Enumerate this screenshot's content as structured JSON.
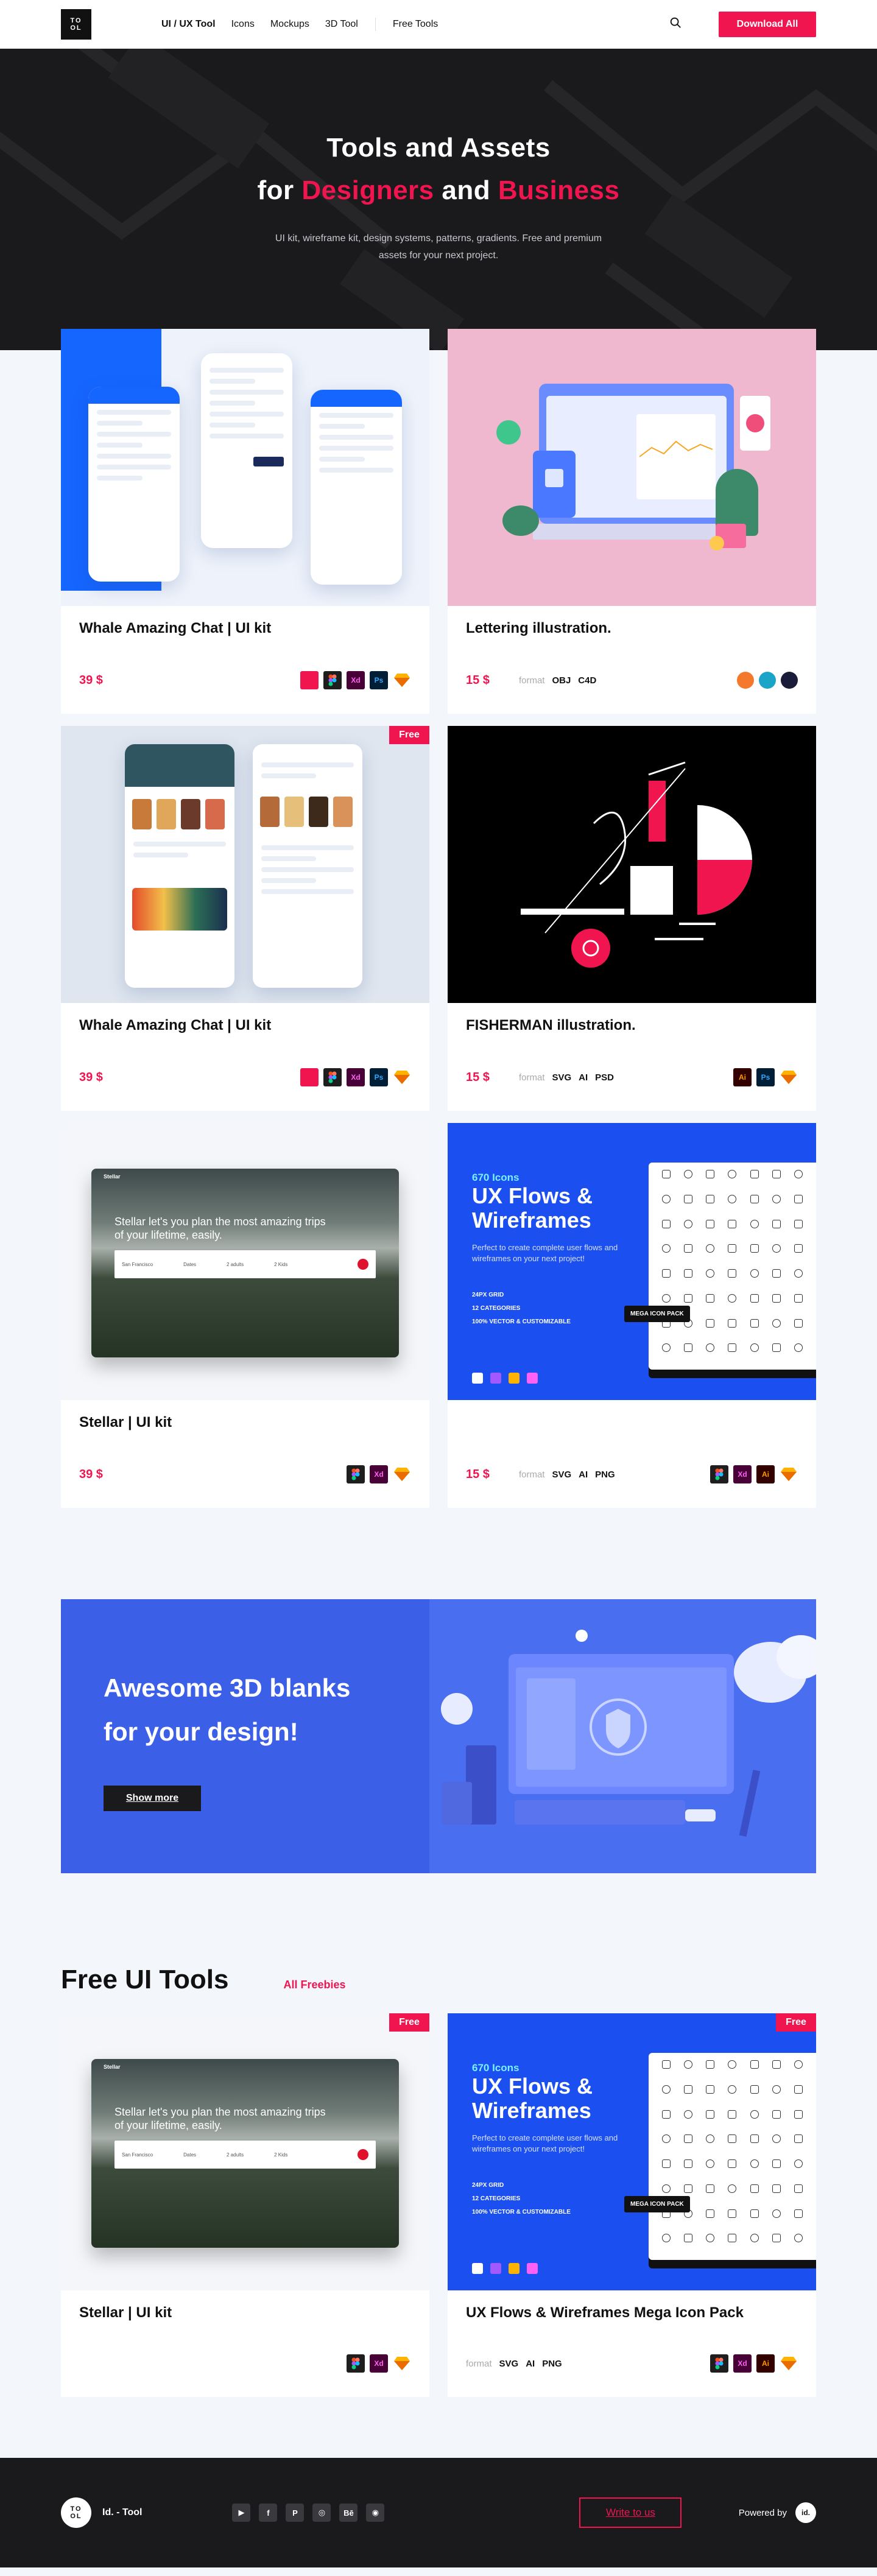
{
  "nav": {
    "logo_top": "TO",
    "logo_bottom": "OL",
    "links": [
      "UI / UX Tool",
      "Icons",
      "Mockups",
      "3D Tool",
      "Free Tools"
    ],
    "download_label": "Download All"
  },
  "hero": {
    "line1": "Tools and Assets",
    "line2_pre": "for ",
    "line2_a": "Designers",
    "line2_mid": " and ",
    "line2_b": "Business",
    "subtitle": "UI kit, wireframe kit, design systems, patterns, gradients. Free and premium assets for your next project."
  },
  "products": [
    {
      "title": "Whale Amazing Chat | UI kit",
      "price": "39 $",
      "format": [],
      "tools": [
        "protopie",
        "figma",
        "xd",
        "ps",
        "sketch"
      ],
      "free": false
    },
    {
      "title": "Lettering  illustration.",
      "price": "15 $",
      "format_label": "format",
      "format": [
        "OBJ",
        "C4D"
      ],
      "tools": [
        "blender",
        "cinema4d",
        "c4d-dark"
      ],
      "free": false
    },
    {
      "title": "Whale Amazing Chat | UI kit",
      "price": "39 $",
      "format": [],
      "tools": [
        "protopie",
        "figma",
        "xd",
        "ps",
        "sketch"
      ],
      "free": true
    },
    {
      "title": "FISHERMAN  illustration.",
      "price": "15 $",
      "format_label": "format",
      "format": [
        "SVG",
        "AI",
        "PSD"
      ],
      "tools": [
        "ai",
        "ps",
        "sketch"
      ],
      "free": false
    },
    {
      "title": "Stellar | UI kit",
      "price": "39 $",
      "format": [],
      "tools": [
        "figma",
        "xd",
        "sketch"
      ],
      "free": false
    },
    {
      "title": "",
      "price": "15 $",
      "format_label": "format",
      "format": [
        "SVG",
        "AI",
        "PNG"
      ],
      "tools": [
        "figma",
        "xd",
        "ai",
        "sketch"
      ],
      "free": false
    }
  ],
  "free_badge": "Free",
  "iconpack": {
    "count": "670 Icons",
    "title": "UX Flows & Wireframes",
    "desc": "Perfect to create complete user flows and wireframes on your next project!",
    "feat1": "24PX GRID",
    "feat2": "12 CATEGORIES",
    "feat3": "100% VECTOR & CUSTOMIZABLE",
    "mega": "MEGA ICON PACK"
  },
  "stellar": {
    "nav_brand": "Stellar",
    "headline": "Stellar let's you plan the most amazing trips of your lifetime, easily.",
    "fields": [
      "San Francisco",
      "Dates",
      "2 adults",
      "2 Kids"
    ]
  },
  "banner": {
    "title_line1": "Awesome 3D blanks",
    "title_line2": "for your design!",
    "button": "Show more"
  },
  "free_section": {
    "heading": "Free UI Tools",
    "link": "All Freebies",
    "items": [
      {
        "title": "Stellar | UI kit",
        "format": [],
        "tools": [
          "figma",
          "xd",
          "sketch"
        ]
      },
      {
        "title": "UX Flows & Wireframes Mega Icon Pack",
        "format_label": "format",
        "format": [
          "SVG",
          "AI",
          "PNG"
        ],
        "tools": [
          "figma",
          "xd",
          "ai",
          "sketch"
        ]
      }
    ]
  },
  "footer": {
    "logo_top": "TO",
    "logo_bottom": "OL",
    "brand": "Id. - Tool",
    "socials": [
      "youtube",
      "facebook",
      "pinterest",
      "instagram",
      "behance",
      "dribbble"
    ],
    "social_glyphs": [
      "▶",
      "f",
      "P",
      "◎",
      "Bē",
      "◉"
    ],
    "write_label": "Write to us",
    "powered_label": "Powered by",
    "powered_logo": "id."
  },
  "colors": {
    "accent": "#f0144f",
    "hero_bg": "#1a1a1c",
    "blue": "#1b4ff0"
  }
}
